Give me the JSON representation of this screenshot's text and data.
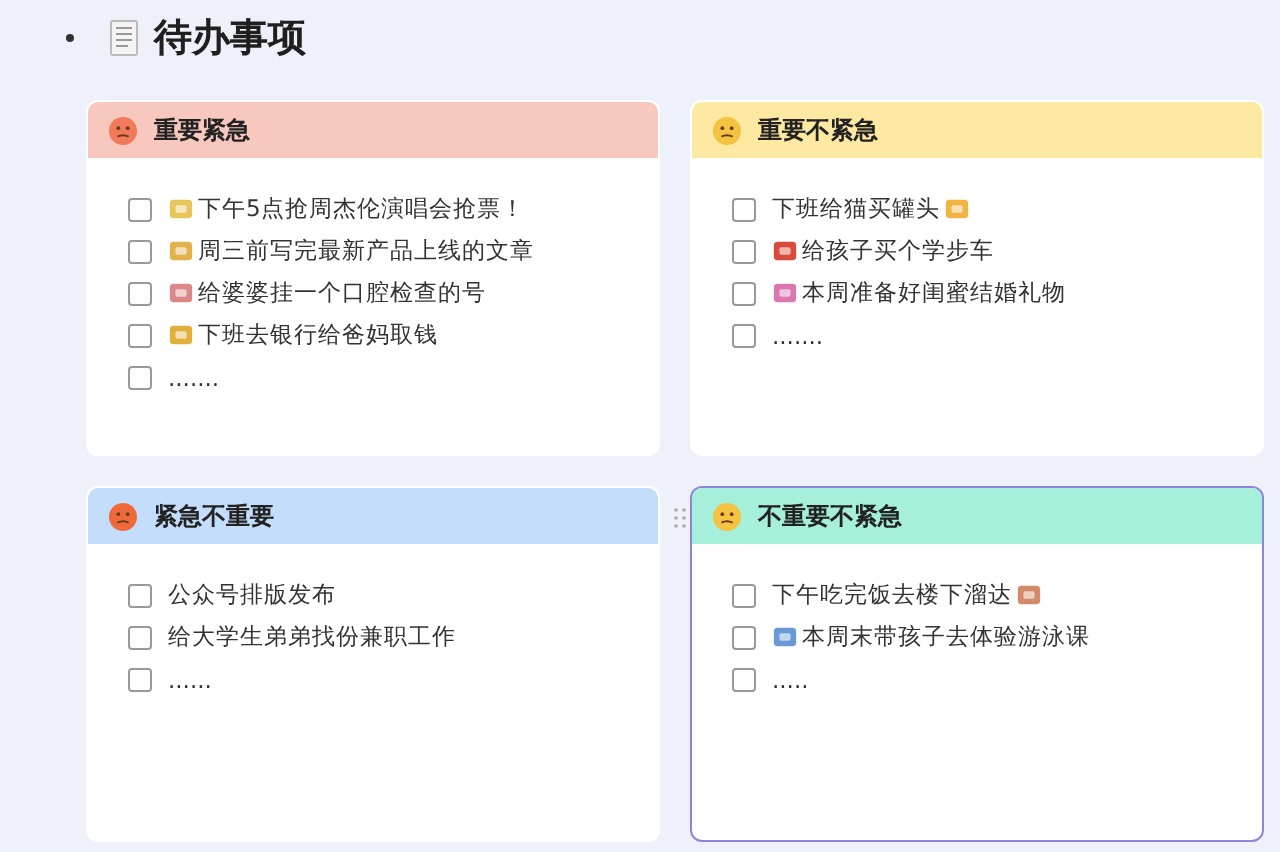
{
  "title": "待办事项",
  "quadrants": [
    {
      "title": "重要紧急",
      "color": "#f8c8bf",
      "selected": false,
      "items": [
        {
          "text": "下午5点抢周杰伦演唱会抢票！",
          "kind": "lead-icon",
          "checked": false
        },
        {
          "text": "周三前写完最新产品上线的文章",
          "kind": "lead-icon",
          "checked": false
        },
        {
          "text": "给婆婆挂一个口腔检查的号",
          "kind": "lead-icon",
          "checked": false
        },
        {
          "text": "下班去银行给爸妈取钱",
          "kind": "lead-icon",
          "checked": false
        },
        {
          "text": ".......",
          "kind": "plain",
          "checked": false
        }
      ]
    },
    {
      "title": "重要不紧急",
      "color": "#fde9a2",
      "selected": false,
      "items": [
        {
          "text": "下班给猫买罐头",
          "kind": "trail-icon",
          "checked": false
        },
        {
          "text": "给孩子买个学步车",
          "kind": "lead-icon",
          "checked": false
        },
        {
          "text": "本周准备好闺蜜结婚礼物",
          "kind": "lead-icon",
          "checked": false
        },
        {
          "text": ".......",
          "kind": "plain",
          "checked": false
        }
      ]
    },
    {
      "title": "紧急不重要",
      "color": "#c4ddfa",
      "selected": false,
      "items": [
        {
          "text": "公众号排版发布",
          "kind": "plain",
          "checked": false
        },
        {
          "text": "给大学生弟弟找份兼职工作",
          "kind": "plain",
          "checked": false
        },
        {
          "text": "......",
          "kind": "plain",
          "checked": false
        }
      ]
    },
    {
      "title": "不重要不紧急",
      "color": "#a5efdb",
      "selected": true,
      "items": [
        {
          "text": "下午吃完饭去楼下溜达",
          "kind": "trail-icon",
          "checked": false
        },
        {
          "text": "本周末带孩子去体验游泳课",
          "kind": "lead-icon",
          "checked": false
        },
        {
          "text": ".....",
          "kind": "plain",
          "checked": false
        }
      ]
    }
  ]
}
